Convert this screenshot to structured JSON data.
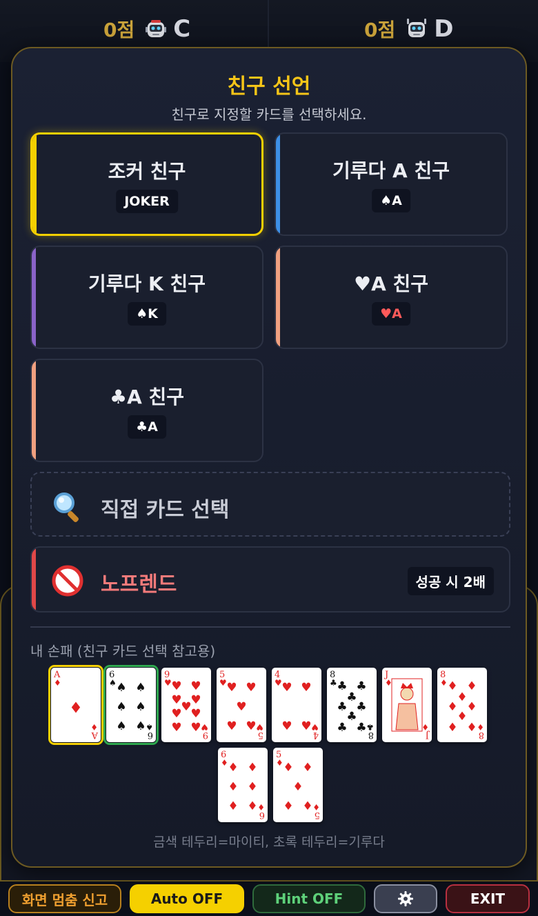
{
  "players": [
    {
      "score": "0점",
      "name": "C"
    },
    {
      "score": "0점",
      "name": "D"
    }
  ],
  "modal": {
    "title": "친구 선언",
    "subtitle": "친구로 지정할 카드를 선택하세요.",
    "options": [
      {
        "label": "조커 친구",
        "chip": "JOKER",
        "accent": "#f5d000",
        "chip_color": "#ffffff",
        "selected": true
      },
      {
        "label": "기루다 A 친구",
        "chip": "♠A",
        "accent": "#3d8fe6",
        "chip_color": "#ffffff",
        "selected": false
      },
      {
        "label": "기루다 K 친구",
        "chip": "♠K",
        "accent": "#8a63c9",
        "chip_color": "#ffffff",
        "selected": false
      },
      {
        "label": "♥A 친구",
        "chip": "♥A",
        "accent": "#f0a080",
        "chip_color": "#ff5a5a",
        "selected": false
      },
      {
        "label": "♣A 친구",
        "chip": "♣A",
        "accent": "#f0a080",
        "chip_color": "#ffffff",
        "selected": false
      }
    ],
    "direct_pick": {
      "label": "직접 카드 선택",
      "icon": "magnifier-icon"
    },
    "no_friend": {
      "label": "노프렌드",
      "badge": "성공 시 2배",
      "icon": "prohibited-icon",
      "color": "#f47a7a"
    },
    "hand_label": "내 손패 (친구 카드 선택 참고용)",
    "hand": [
      {
        "rank": "A",
        "suit": "♦",
        "color": "red",
        "border": "mighty"
      },
      {
        "rank": "6",
        "suit": "♠",
        "color": "black",
        "border": "girooda"
      },
      {
        "rank": "9",
        "suit": "♥",
        "color": "red",
        "border": ""
      },
      {
        "rank": "5",
        "suit": "♥",
        "color": "red",
        "border": ""
      },
      {
        "rank": "4",
        "suit": "♥",
        "color": "red",
        "border": ""
      },
      {
        "rank": "8",
        "suit": "♣",
        "color": "black",
        "border": ""
      },
      {
        "rank": "J",
        "suit": "♦",
        "color": "red",
        "border": ""
      },
      {
        "rank": "8",
        "suit": "♦",
        "color": "red",
        "border": ""
      },
      {
        "rank": "6",
        "suit": "♦",
        "color": "red",
        "border": ""
      },
      {
        "rank": "5",
        "suit": "♦",
        "color": "red",
        "border": ""
      }
    ],
    "legend": "금색 테두리=마이티, 초록 테두리=기루다"
  },
  "bottom_bar": {
    "report": "화면 멈춤 신고",
    "auto": "Auto OFF",
    "hint": "Hint OFF",
    "settings_icon": "gear-icon",
    "exit": "EXIT"
  },
  "colors": {
    "gold": "#f5c518",
    "modal_border": "#6d5a22",
    "card_red": "#e02020",
    "card_black": "#111111"
  }
}
